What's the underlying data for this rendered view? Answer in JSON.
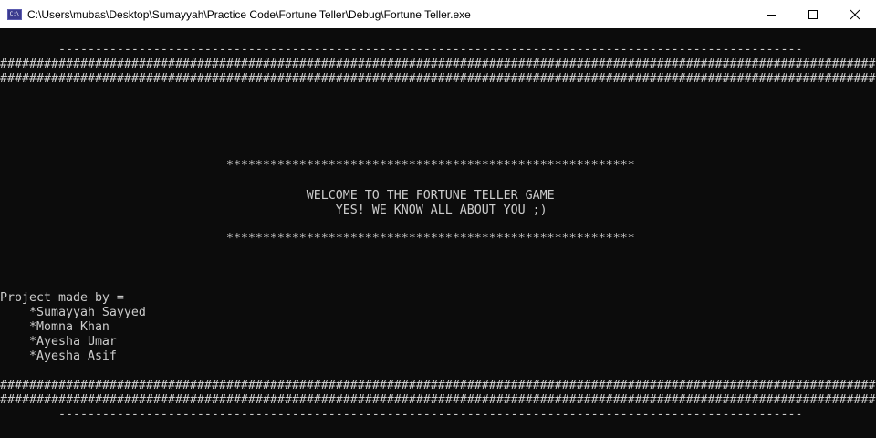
{
  "window": {
    "title": "C:\\Users\\mubas\\Desktop\\Sumayyah\\Practice Code\\Fortune Teller\\Debug\\Fortune Teller.exe",
    "app_icon_text": "C:\\"
  },
  "console": {
    "dash_line": "        ------------------------------------------------------------------------------------------------------",
    "hash_line": "########################################################################################################################",
    "star_line": "                               ********************************************************",
    "welcome_line": "                                          WELCOME TO THE FORTUNE TELLER GAME",
    "yes_line": "                                              YES! WE KNOW ALL ABOUT YOU ;)",
    "credits_heading": "Project made by =",
    "members": [
      "    *Sumayyah Sayyed",
      "    *Momna Khan",
      "    *Ayesha Umar",
      "    *Ayesha Asif"
    ]
  },
  "colors": {
    "console_bg": "#0c0c0c",
    "console_text": "#cccccc",
    "titlebar_bg": "#ffffff"
  }
}
